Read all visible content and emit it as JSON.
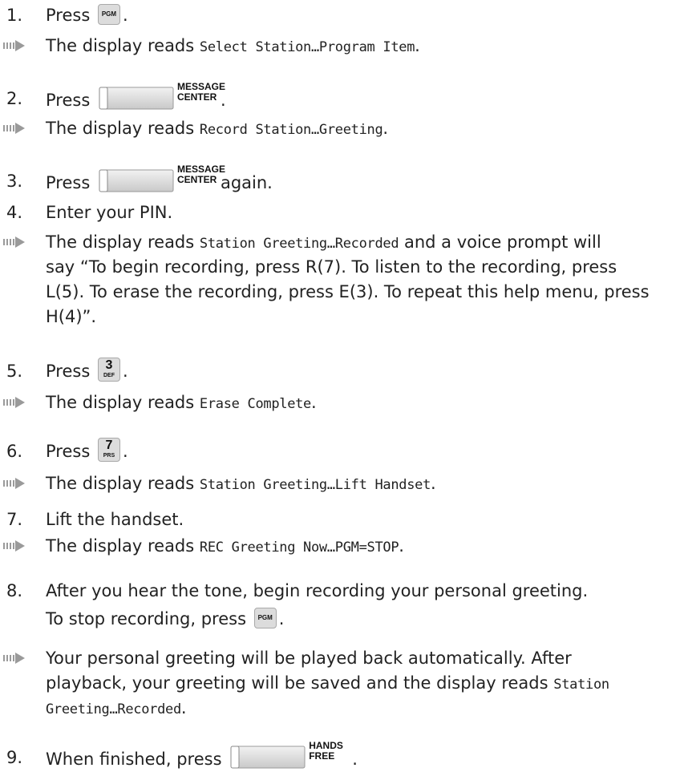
{
  "steps": [
    {
      "num": "1.",
      "pre": "Press",
      "key": "PGM",
      "post": "."
    },
    {
      "num": "2.",
      "pre": "Press",
      "key_line1": "MESSAGE",
      "key_line2": "CENTER",
      "post": "."
    },
    {
      "num": "3.",
      "pre": "Press",
      "key_line1": "MESSAGE",
      "key_line2": "CENTER",
      "post": "again."
    },
    {
      "num": "4.",
      "text": "Enter your PIN."
    },
    {
      "num": "5.",
      "pre": "Press",
      "digit": "3",
      "letters": "DEF",
      "post": "."
    },
    {
      "num": "6.",
      "pre": "Press",
      "digit": "7",
      "letters": "PRS",
      "post": "."
    },
    {
      "num": "7.",
      "text": "Lift the handset."
    },
    {
      "num": "8.",
      "text": "After you hear the tone, begin recording your personal greeting.",
      "line2_pre": "To stop recording, press",
      "key": "PGM",
      "post": "."
    },
    {
      "num": "9.",
      "pre": "When finished, press",
      "key_line1": "HANDS",
      "key_line2": "FREE",
      "post": "."
    }
  ],
  "results": [
    {
      "pre": "The display reads",
      "display": "Select Station…Program Item",
      "post": "."
    },
    {
      "pre": "The display reads",
      "display": "Record Station…Greeting",
      "post": "."
    },
    {
      "pre": "The display reads",
      "display": "Station Greeting…Recorded",
      "post_line1": "and a voice prompt will",
      "line2": "say “To begin recording, press R(7). To listen to the recording, press",
      "line3": "L(5). To erase the recording, press E(3). To repeat this help menu, press",
      "line4": "H(4)”."
    },
    {
      "pre": "The display reads",
      "display": "Erase Complete",
      "post": "."
    },
    {
      "pre": "The display reads",
      "display": "Station Greeting…Lift Handset",
      "post": "."
    },
    {
      "pre": "The display reads",
      "display": "REC Greeting Now…PGM=STOP",
      "post": "."
    },
    {
      "line1": "Your personal greeting will be played back automatically. After",
      "line2_pre": "playback, your greeting will be saved and the display reads",
      "display_a": "Station",
      "display_b": "Greeting…Recorded",
      "post": "."
    }
  ],
  "icons": {
    "arrow": "result-arrow-icon"
  },
  "colors": {
    "arrow": "#9a9a9a",
    "key_face": "#dcdcdc",
    "key_border": "#a9a9a9",
    "text": "#222222"
  }
}
